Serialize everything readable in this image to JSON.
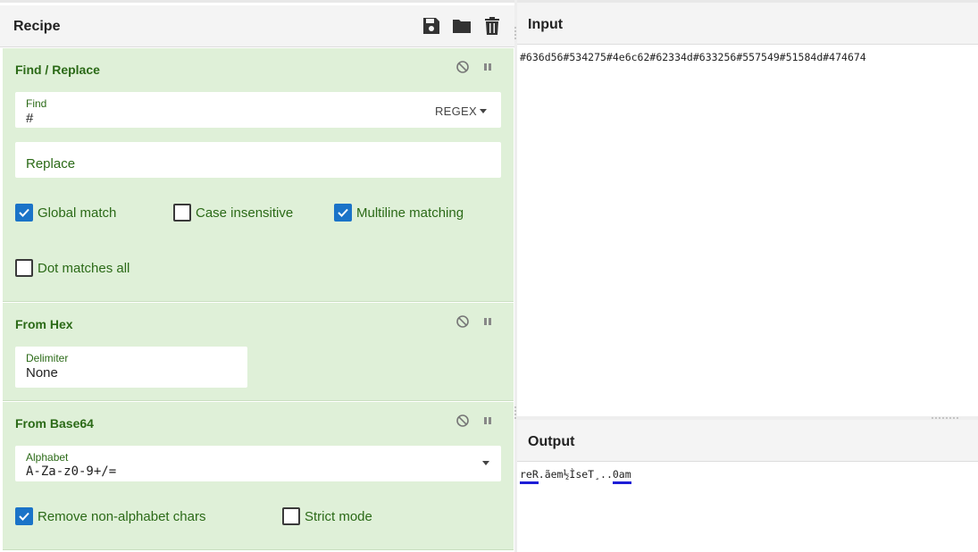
{
  "recipe": {
    "title": "Recipe",
    "icons": [
      "save-icon",
      "folder-icon",
      "trash-icon"
    ]
  },
  "operations": {
    "find_replace": {
      "title": "Find / Replace",
      "find_label": "Find",
      "find_value": "#",
      "regex_label": "REGEX",
      "replace_placeholder": "Replace",
      "options": [
        {
          "label": "Global match",
          "checked": true
        },
        {
          "label": "Case insensitive",
          "checked": false
        },
        {
          "label": "Multiline matching",
          "checked": true
        },
        {
          "label": "Dot matches all",
          "checked": false
        }
      ]
    },
    "from_hex": {
      "title": "From Hex",
      "delimiter_label": "Delimiter",
      "delimiter_value": "None"
    },
    "from_base64": {
      "title": "From Base64",
      "alphabet_label": "Alphabet",
      "alphabet_value": "A-Za-z0-9+/=",
      "options": [
        {
          "label": "Remove non-alphabet chars",
          "checked": true
        },
        {
          "label": "Strict mode",
          "checked": false
        }
      ]
    }
  },
  "input": {
    "title": "Input",
    "text": "#636d56#534275#4e6c62#62334d#633256#557549#51584d#474674"
  },
  "output": {
    "title": "Output",
    "segments": [
      "reR",
      ".ãem½ÌseT¸..",
      "0am"
    ]
  },
  "colors": {
    "op_bg": "#dff0d8",
    "op_text": "#2b6a17",
    "checkbox_checked": "#1a73c8",
    "highlight_underline": "#1d1dd6"
  }
}
